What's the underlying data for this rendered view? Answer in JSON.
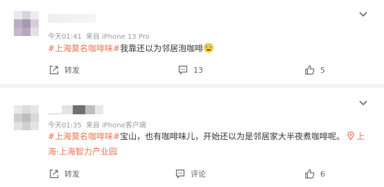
{
  "posts": [
    {
      "meta_time": "今天01:41",
      "meta_source": "来自 iPhone 13 Pro",
      "hashtag": "#上海莫名咖啡味#",
      "text": "我靠还以为邻居泡咖啡",
      "emoji": "crying-face",
      "repost_label": "转发",
      "comment_count": "13",
      "like_count": "5"
    },
    {
      "meta_time": "今天01:35",
      "meta_source": "来自 iPhone客户端",
      "hashtag": "#上海莫名咖啡味#",
      "text": "宝山，也有咖啡味儿，开始还以为是邻居家大半夜煮咖啡呢。",
      "location": "上海·上海智力产业园",
      "repost_label": "转发",
      "comment_label": "评论",
      "like_count": "6"
    }
  ],
  "colors": {
    "accent": "#eb7350",
    "text": "#333333",
    "meta": "#999999",
    "background": "#f2f2f2"
  },
  "icons": [
    "chevron-down-icon",
    "repost-icon",
    "comment-icon",
    "like-icon",
    "location-pin-icon"
  ]
}
